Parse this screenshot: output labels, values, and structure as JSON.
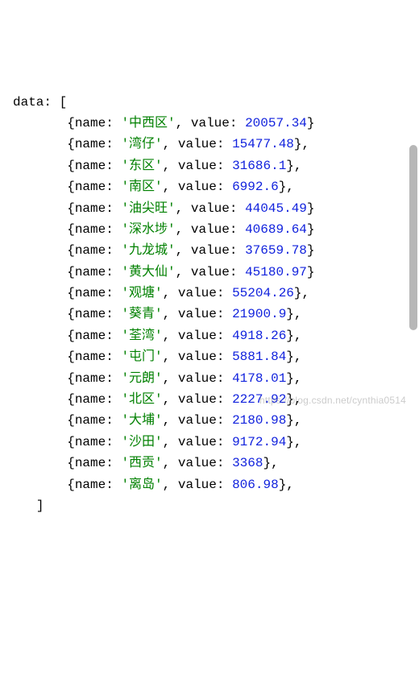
{
  "code": {
    "var_name": "data",
    "open": "[",
    "close": "]",
    "key_name": "name",
    "key_value": "value",
    "entries": [
      {
        "name": "中西区",
        "value": "20057.34",
        "trailing_comma": false
      },
      {
        "name": "湾仔",
        "value": "15477.48",
        "trailing_comma": true
      },
      {
        "name": "东区",
        "value": "31686.1",
        "trailing_comma": true
      },
      {
        "name": "南区",
        "value": "6992.6",
        "trailing_comma": true
      },
      {
        "name": "油尖旺",
        "value": "44045.49",
        "trailing_comma": false
      },
      {
        "name": "深水埗",
        "value": "40689.64",
        "trailing_comma": false
      },
      {
        "name": "九龙城",
        "value": "37659.78",
        "trailing_comma": false
      },
      {
        "name": "黄大仙",
        "value": "45180.97",
        "trailing_comma": false
      },
      {
        "name": "观塘",
        "value": "55204.26",
        "trailing_comma": true
      },
      {
        "name": "葵青",
        "value": "21900.9",
        "trailing_comma": true
      },
      {
        "name": "荃湾",
        "value": "4918.26",
        "trailing_comma": true
      },
      {
        "name": "屯门",
        "value": "5881.84",
        "trailing_comma": true
      },
      {
        "name": "元朗",
        "value": "4178.01",
        "trailing_comma": true
      },
      {
        "name": "北区",
        "value": "2227.92",
        "trailing_comma": true
      },
      {
        "name": "大埔",
        "value": "2180.98",
        "trailing_comma": true
      },
      {
        "name": "沙田",
        "value": "9172.94",
        "trailing_comma": true
      },
      {
        "name": "西贡",
        "value": "3368",
        "trailing_comma": true
      },
      {
        "name": "离岛",
        "value": "806.98",
        "trailing_comma": true
      }
    ]
  },
  "watermark": "https://blog.csdn.net/cynthia0514",
  "indent": {
    "lead": "       ",
    "close_lead": "   "
  }
}
